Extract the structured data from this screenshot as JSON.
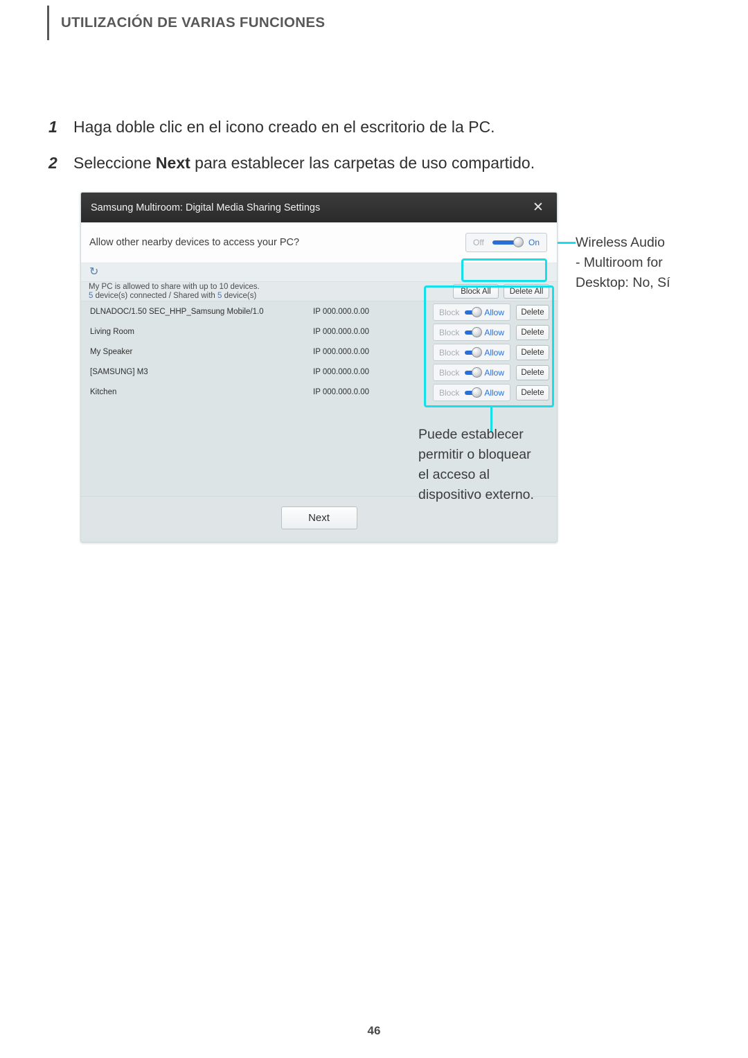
{
  "header": {
    "title": "UTILIZACIÓN DE VARIAS FUNCIONES"
  },
  "steps": [
    {
      "number": "1",
      "text_before": "Haga doble clic en el icono creado en el escritorio de la PC.",
      "bold": "",
      "text_after": ""
    },
    {
      "number": "2",
      "text_before": "Seleccione ",
      "bold": "Next",
      "text_after": " para establecer las carpetas de uso compartido."
    }
  ],
  "dialog": {
    "title": "Samsung Multiroom: Digital Media Sharing Settings",
    "close_icon": "close-icon",
    "close_glyph": "✕",
    "allow_question": "Allow other nearby devices to access your PC?",
    "master_toggle": {
      "off_label": "Off",
      "on_label": "On",
      "state": "On"
    },
    "refresh_icon": "refresh-icon",
    "refresh_glyph": "↻",
    "list_header": {
      "line1": "My PC is allowed to share with up to 10 devices.",
      "line2_count1": "5",
      "line2_mid": " device(s) connected / Shared with ",
      "line2_count2": "5",
      "line2_end": " device(s)",
      "block_all_label": "Block All",
      "delete_all_label": "Delete All"
    },
    "row_toggle": {
      "block_label": "Block",
      "allow_label": "Allow",
      "state": "Allow"
    },
    "delete_label": "Delete",
    "devices": [
      {
        "name": "DLNADOC/1.50 SEC_HHP_Samsung Mobile/1.0",
        "ip": "IP 000.000.0.00"
      },
      {
        "name": "Living Room",
        "ip": "IP 000.000.0.00"
      },
      {
        "name": "My Speaker",
        "ip": "IP 000.000.0.00"
      },
      {
        "name": "[SAMSUNG] M3",
        "ip": "IP 000.000.0.00"
      },
      {
        "name": "Kitchen",
        "ip": "IP 000.000.0.00"
      }
    ],
    "next_label": "Next"
  },
  "callouts": {
    "top": "Wireless Audio - Multiroom for Desktop: No, Sí",
    "top_lines": [
      "Wireless Audio",
      "- Multiroom for",
      "Desktop: No, Sí"
    ],
    "bottom": "Puede establecer permitir o bloquear el acceso al dispositivo externo.",
    "bottom_lines": [
      "Puede establecer",
      "permitir o bloquear",
      "el acceso al",
      "dispositivo externo."
    ]
  },
  "colors": {
    "accent_cyan": "#17dfe9",
    "link_blue": "#2b6fd6",
    "titlebar_dark": "#323232"
  },
  "page_number": "46"
}
